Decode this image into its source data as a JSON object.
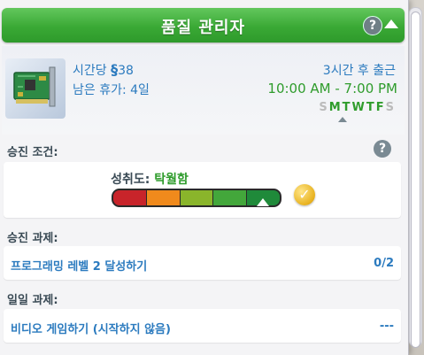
{
  "header": {
    "title": "품질 관리자",
    "help_label": "?"
  },
  "job": {
    "wage_prefix": "시간당",
    "wage_symbol": "§",
    "wage_amount": "38",
    "vacation": "남은 휴가: 4일",
    "work_in": "3시간 후 출근",
    "hours": "10:00  AM - 7:00  PM",
    "days": [
      {
        "letter": "S",
        "active": false
      },
      {
        "letter": "M",
        "active": true
      },
      {
        "letter": "T",
        "active": true
      },
      {
        "letter": "W",
        "active": true
      },
      {
        "letter": "T",
        "active": true
      },
      {
        "letter": "F",
        "active": true
      },
      {
        "letter": "S",
        "active": false
      }
    ]
  },
  "promotion": {
    "label": "승진 조건:",
    "help_label": "?",
    "performance_label": "성취도: ",
    "performance_value": "탁월함",
    "performance_level": 0.89,
    "segment_colors": [
      "#c8242a",
      "#f08a1c",
      "#8ab52b",
      "#43a73b",
      "#1f8a3a"
    ]
  },
  "promotion_tasks": {
    "label": "승진 과제:",
    "items": [
      {
        "text": "프로그래밍 레벨 2 달성하기",
        "progress": "0/2"
      }
    ]
  },
  "daily_tasks": {
    "label": "일일 과제:",
    "items": [
      {
        "text": "비디오 게임하기 (시작하지 않음)",
        "progress": "---"
      }
    ]
  },
  "colors": {
    "header_green": "#3aa935",
    "accent_blue": "#2c7bbf",
    "active_green": "#2f9c2c"
  }
}
